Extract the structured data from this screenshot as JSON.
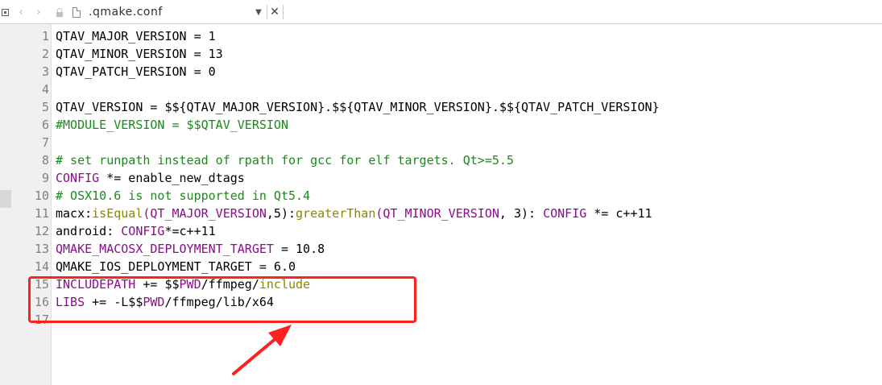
{
  "tab": {
    "title": ".qmake.conf",
    "panel_icon": "panel-icon",
    "back_icon": "chevron-left-icon",
    "forward_icon": "chevron-right-icon",
    "lock_icon": "lock-icon",
    "file_icon": "file-icon",
    "dropdown_icon": "triangle-down-icon",
    "close_icon": "close-icon"
  },
  "colors": {
    "keyword": "#8b0d8b",
    "function": "#888800",
    "comment": "#1a8a1a",
    "highlight_border": "#ff2020"
  },
  "lines": [
    {
      "n": "1",
      "tokens": [
        {
          "t": "QTAV_MAJOR_VERSION = 1",
          "c": "pl"
        }
      ]
    },
    {
      "n": "2",
      "tokens": [
        {
          "t": "QTAV_MINOR_VERSION = 13",
          "c": "pl"
        }
      ]
    },
    {
      "n": "3",
      "tokens": [
        {
          "t": "QTAV_PATCH_VERSION = 0",
          "c": "pl"
        }
      ]
    },
    {
      "n": "4",
      "tokens": []
    },
    {
      "n": "5",
      "tokens": [
        {
          "t": "QTAV_VERSION = $${QTAV_MAJOR_VERSION}.$${QTAV_MINOR_VERSION}.$${QTAV_PATCH_VERSION}",
          "c": "pl"
        }
      ]
    },
    {
      "n": "6",
      "tokens": [
        {
          "t": "#MODULE_VERSION = $$QTAV_VERSION",
          "c": "cm"
        }
      ]
    },
    {
      "n": "7",
      "tokens": []
    },
    {
      "n": "8",
      "tokens": [
        {
          "t": "# set runpath instead of rpath for gcc for elf targets. Qt>=5.5",
          "c": "cm"
        }
      ]
    },
    {
      "n": "9",
      "tokens": [
        {
          "t": "CONFIG",
          "c": "kw"
        },
        {
          "t": " *= enable_new_dtags",
          "c": "pl"
        }
      ]
    },
    {
      "n": "10",
      "tokens": [
        {
          "t": "# OSX10.6 is not supported in Qt5.4",
          "c": "cm"
        }
      ]
    },
    {
      "n": "11",
      "tokens": [
        {
          "t": "macx:",
          "c": "pl"
        },
        {
          "t": "isEqual",
          "c": "fn"
        },
        {
          "t": "(",
          "c": "kw"
        },
        {
          "t": "QT_MAJOR_VERSION",
          "c": "kw"
        },
        {
          "t": ",5):",
          "c": "pl"
        },
        {
          "t": "greaterThan",
          "c": "fn"
        },
        {
          "t": "(",
          "c": "kw"
        },
        {
          "t": "QT_MINOR_VERSION",
          "c": "kw"
        },
        {
          "t": ", 3): ",
          "c": "pl"
        },
        {
          "t": "CONFIG",
          "c": "kw"
        },
        {
          "t": " *= c++11",
          "c": "pl"
        }
      ]
    },
    {
      "n": "12",
      "tokens": [
        {
          "t": "android: ",
          "c": "pl"
        },
        {
          "t": "CONFIG",
          "c": "kw"
        },
        {
          "t": "*=c++11",
          "c": "pl"
        }
      ]
    },
    {
      "n": "13",
      "tokens": [
        {
          "t": "QMAKE_MACOSX_DEPLOYMENT_TARGET",
          "c": "kw"
        },
        {
          "t": " = 10.8",
          "c": "pl"
        }
      ]
    },
    {
      "n": "14",
      "tokens": [
        {
          "t": "QMAKE_IOS_DEPLOYMENT_TARGET = 6.0",
          "c": "pl"
        }
      ]
    },
    {
      "n": "15",
      "tokens": [
        {
          "t": "INCLUDEPATH",
          "c": "kw"
        },
        {
          "t": " += $$",
          "c": "pl"
        },
        {
          "t": "PWD",
          "c": "kw"
        },
        {
          "t": "/ffmpeg/",
          "c": "pl"
        },
        {
          "t": "include",
          "c": "fn"
        }
      ]
    },
    {
      "n": "16",
      "tokens": [
        {
          "t": "LIBS",
          "c": "kw"
        },
        {
          "t": " += -L$$",
          "c": "pl"
        },
        {
          "t": "PWD",
          "c": "kw"
        },
        {
          "t": "/ffmpeg/lib/x64",
          "c": "pl"
        }
      ]
    },
    {
      "n": "17",
      "tokens": []
    }
  ]
}
